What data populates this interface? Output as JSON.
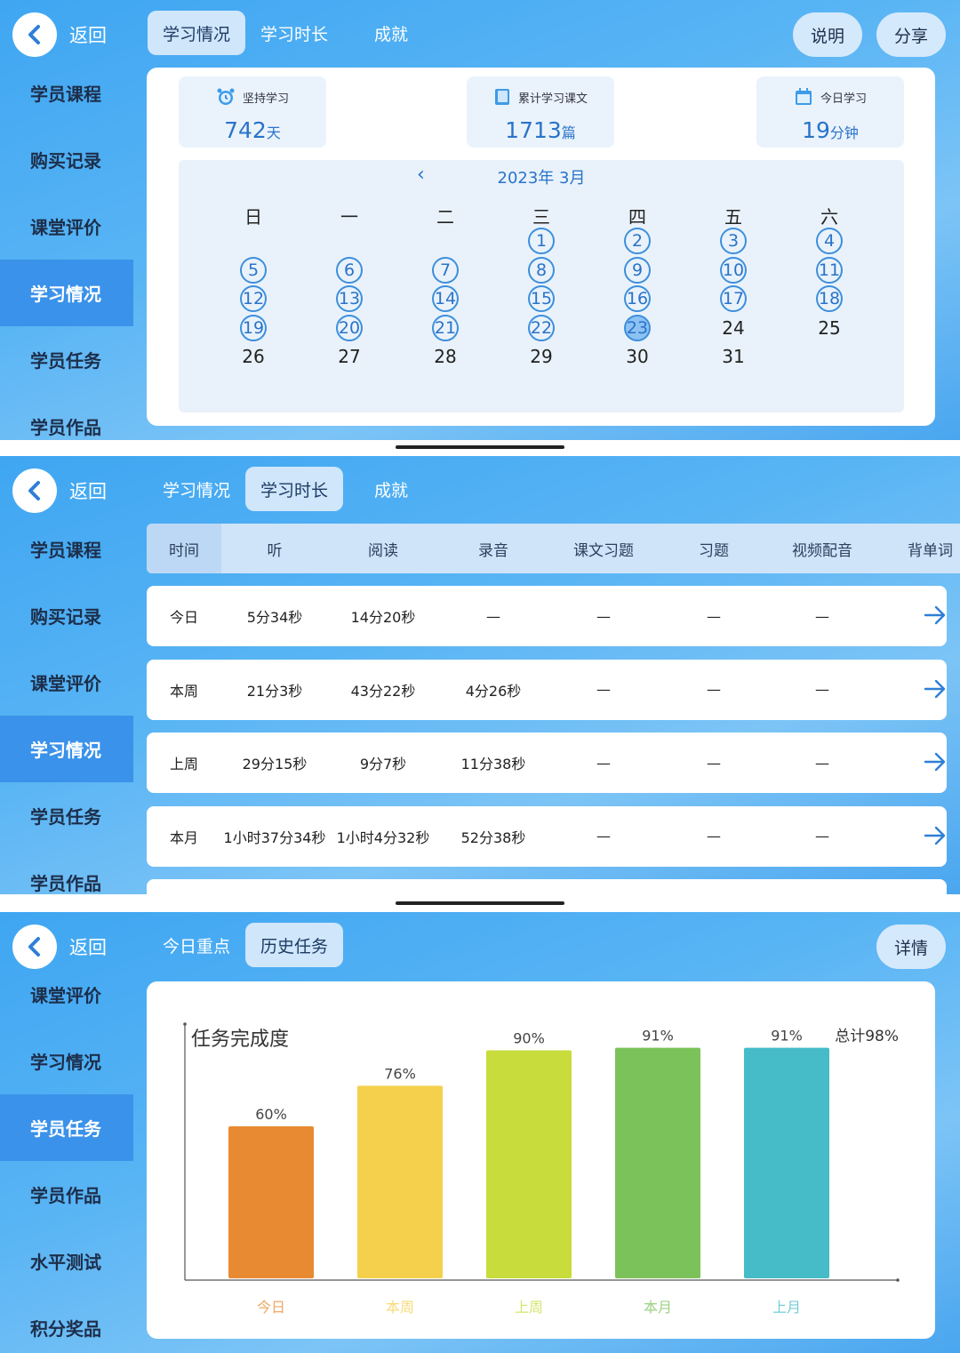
{
  "common": {
    "back_label": "返回"
  },
  "panel1": {
    "sidebar": [
      "学员课程",
      "购买记录",
      "课堂评价",
      "学习情况",
      "学员任务",
      "学员作品"
    ],
    "tabs": [
      "学习情况",
      "学习时长",
      "成就"
    ],
    "buttons": {
      "explain": "说明",
      "share": "分享"
    },
    "stats": [
      {
        "icon": "alarm-clock-icon",
        "label": "坚持学习",
        "value": "742",
        "unit": "天"
      },
      {
        "icon": "book-icon",
        "label": "累计学习课文",
        "value": "1713",
        "unit": "篇"
      },
      {
        "icon": "calendar-icon",
        "label": "今日学习",
        "value": "19",
        "unit": "分钟"
      }
    ],
    "calendar": {
      "title": "2023年 3月",
      "weekdays": [
        "日",
        "一",
        "二",
        "三",
        "四",
        "五",
        "六"
      ],
      "days": [
        "1",
        "2",
        "3",
        "4",
        "5",
        "6",
        "7",
        "8",
        "9",
        "10",
        "11",
        "12",
        "13",
        "14",
        "15",
        "16",
        "17",
        "18",
        "19",
        "20",
        "21",
        "22",
        "23",
        "24",
        "25",
        "26",
        "27",
        "28",
        "29",
        "30",
        "31"
      ],
      "first_weekday": 3,
      "studied_through": 23,
      "today": 23
    }
  },
  "panel2": {
    "sidebar": [
      "学员课程",
      "购买记录",
      "课堂评价",
      "学习情况",
      "学员任务",
      "学员作品"
    ],
    "tabs": [
      "学习情况",
      "学习时长",
      "成就"
    ],
    "columns": [
      "时间",
      "听",
      "阅读",
      "录音",
      "课文习题",
      "习题",
      "视频配音",
      "背单词"
    ],
    "rows": [
      {
        "period": "今日",
        "listen": "5分34秒",
        "read": "14分20秒",
        "record": "—",
        "text_ex": "—",
        "ex": "—",
        "dub": "—"
      },
      {
        "period": "本周",
        "listen": "21分3秒",
        "read": "43分22秒",
        "record": "4分26秒",
        "text_ex": "—",
        "ex": "—",
        "dub": "—"
      },
      {
        "period": "上周",
        "listen": "29分15秒",
        "read": "9分7秒",
        "record": "11分38秒",
        "text_ex": "—",
        "ex": "—",
        "dub": "—"
      },
      {
        "period": "本月",
        "listen": "1小时37分34秒",
        "read": "1小时4分32秒",
        "record": "52分38秒",
        "text_ex": "—",
        "ex": "—",
        "dub": "—"
      }
    ]
  },
  "panel3": {
    "sidebar": [
      "课堂评价",
      "学习情况",
      "学员任务",
      "学员作品",
      "水平测试",
      "积分奖品"
    ],
    "tabs": [
      "今日重点",
      "历史任务"
    ],
    "detail_button": "详情",
    "total": "总计98%",
    "colors": [
      "#e88a31",
      "#f4d04c",
      "#c8dc3c",
      "#7cc25a",
      "#45bcc8"
    ]
  },
  "chart_data": {
    "type": "bar",
    "title": "任务完成度",
    "categories": [
      "今日",
      "本周",
      "上周",
      "本月",
      "上月"
    ],
    "values": [
      60,
      76,
      90,
      91,
      91
    ],
    "value_labels": [
      "60%",
      "76%",
      "90%",
      "91%",
      "91%"
    ],
    "ylim": [
      0,
      100
    ],
    "grid": false,
    "legend": "none"
  }
}
